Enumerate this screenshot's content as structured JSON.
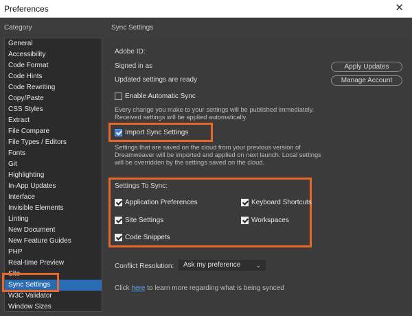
{
  "window": {
    "title": "Preferences",
    "close_glyph": "✕"
  },
  "left": {
    "header": "Category",
    "items": [
      "General",
      "Accessibility",
      "Code Format",
      "Code Hints",
      "Code Rewriting",
      "Copy/Paste",
      "CSS Styles",
      "Extract",
      "File Compare",
      "File Types / Editors",
      "Fonts",
      "Git",
      "Highlighting",
      "In-App Updates",
      "Interface",
      "Invisible Elements",
      "Linting",
      "New Document",
      "New Feature Guides",
      "PHP",
      "Real-time Preview",
      "Site",
      "Sync Settings",
      "W3C Validator",
      "Window Sizes"
    ],
    "selected": "Sync Settings"
  },
  "panel": {
    "header": "Sync Settings",
    "adobe_id_label": "Adobe ID:",
    "signed_in_label": "Signed in as",
    "updated_label": "Updated settings are ready",
    "apply_updates": "Apply Updates",
    "manage_account": "Manage Account",
    "enable_auto_sync": {
      "label": "Enable Automatic Sync",
      "checked": false
    },
    "auto_sync_desc_1": "Every change you make to your settings will be published immediately.",
    "auto_sync_desc_2": "Received settings will be applied automatically.",
    "import_sync": {
      "label": "Import Sync Settings",
      "checked": true
    },
    "import_desc_1": "Settings that are saved on the cloud from your previous version of",
    "import_desc_2": "Dreamweaver will be imported and applied on next launch. Local settings",
    "import_desc_3": "will be overridden by the settings saved on the cloud.",
    "settings_to_sync_label": "Settings To Sync:",
    "sync_items": {
      "app_prefs": {
        "label": "Application Preferences",
        "checked": true
      },
      "keyboard": {
        "label": "Keyboard Shortcuts",
        "checked": true
      },
      "site_settings": {
        "label": "Site Settings",
        "checked": true
      },
      "workspaces": {
        "label": "Workspaces",
        "checked": true
      },
      "code_snippets": {
        "label": "Code Snippets",
        "checked": true
      }
    },
    "conflict_label": "Conflict Resolution:",
    "conflict_value": "Ask my preference",
    "caret_glyph": "⌄",
    "footer_prefix": "Click",
    "footer_link": "here",
    "footer_suffix": "to learn more regarding what is being synced"
  },
  "colors": {
    "highlight": "#e8672a",
    "selection": "#2a6cb3",
    "link": "#5aa3ee"
  }
}
